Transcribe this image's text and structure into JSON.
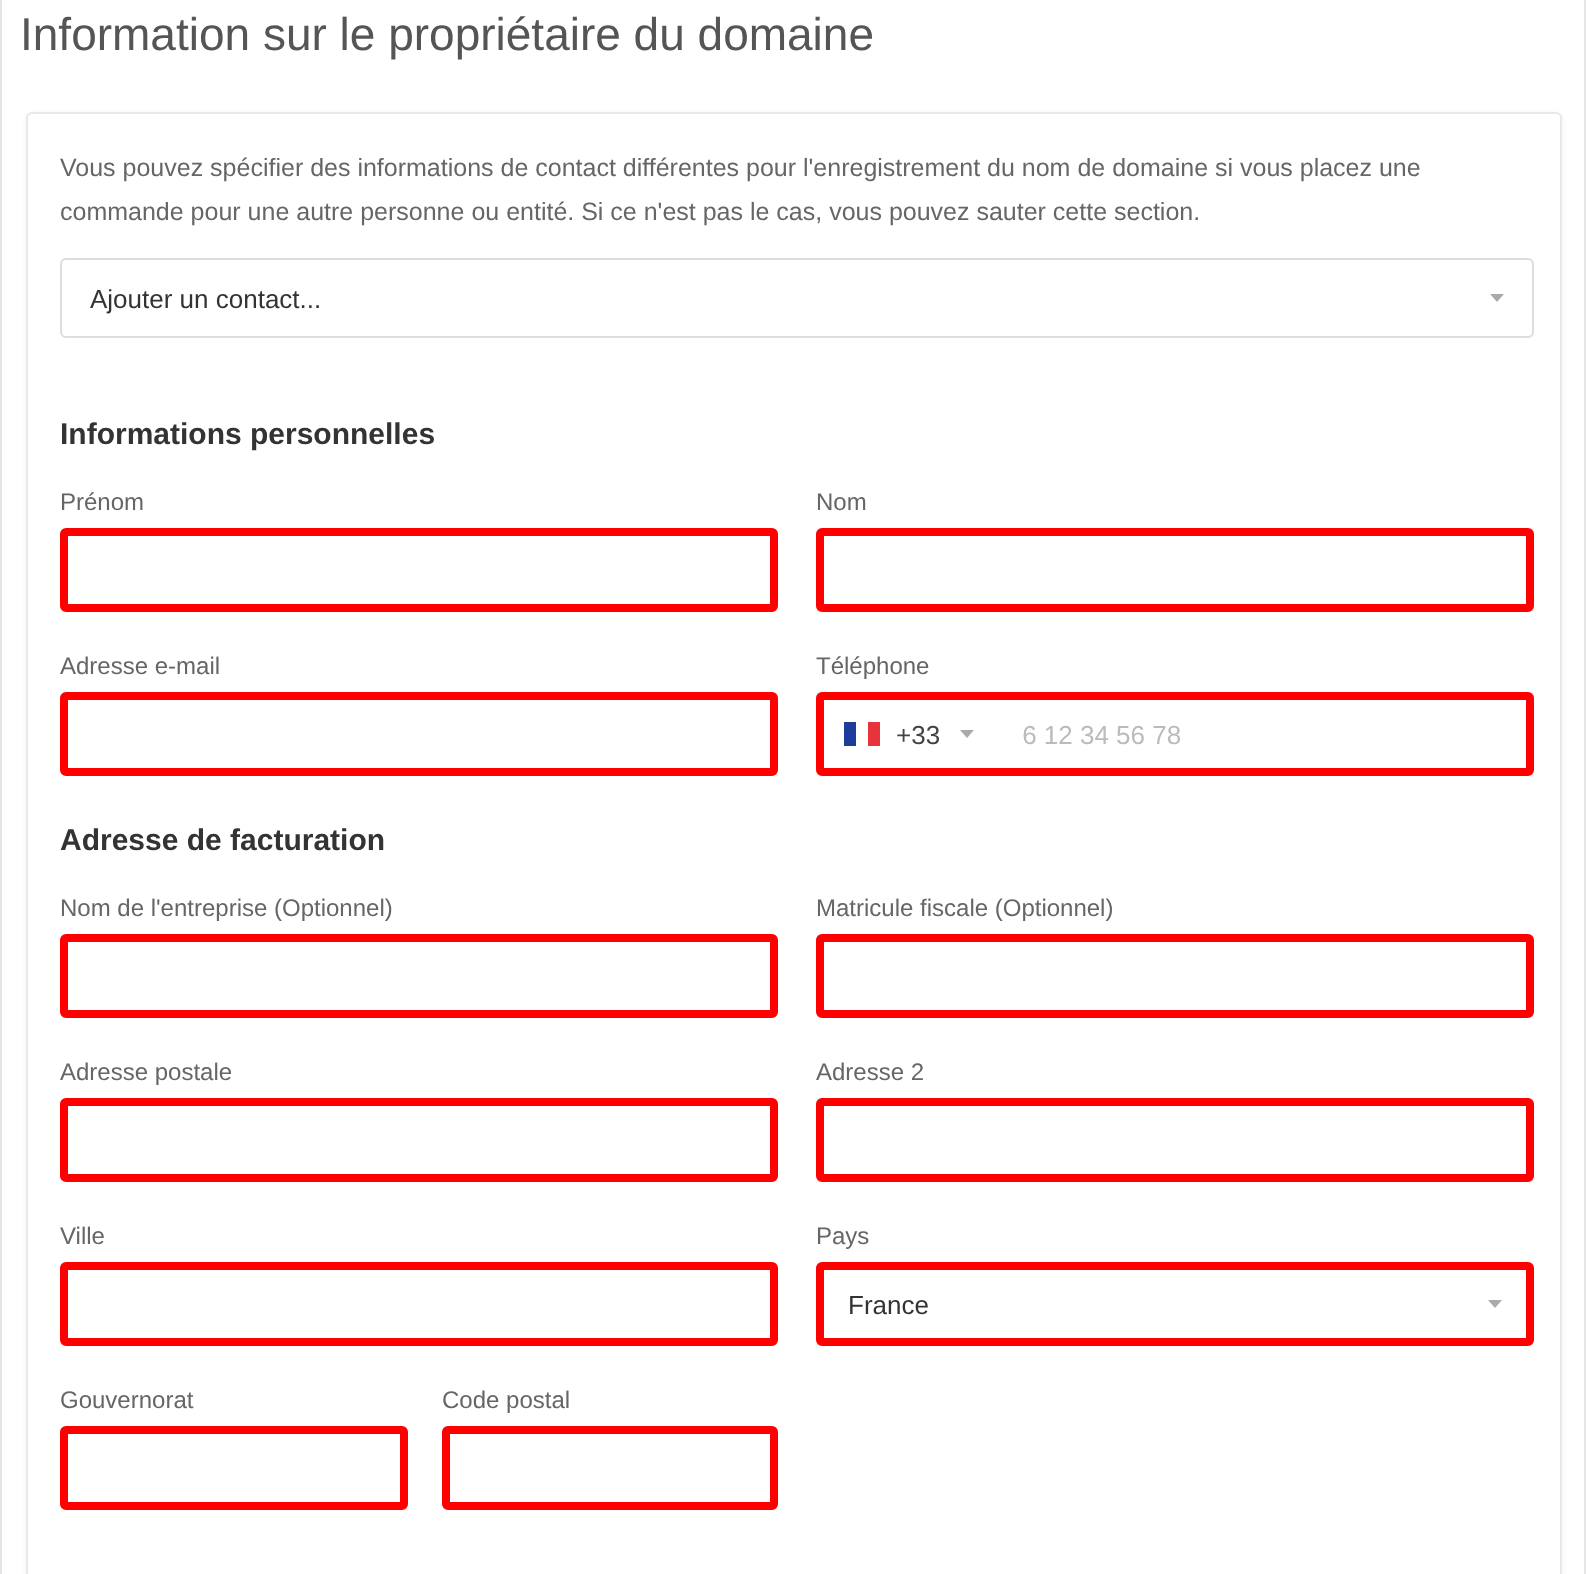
{
  "title": "Information sur le propriétaire du domaine",
  "intro": "Vous pouvez spécifier des informations de contact différentes pour l'enregistrement du nom de domaine si vous placez une commande pour une autre personne ou entité. Si ce n'est pas le cas, vous pouvez sauter cette section.",
  "contact_select": {
    "value": "Ajouter un contact..."
  },
  "sections": [
    {
      "heading": "Informations personnelles",
      "rows": [
        [
          {
            "label": "Prénom",
            "kind": "text",
            "invalid": true
          },
          {
            "label": "Nom",
            "kind": "text",
            "invalid": true
          }
        ],
        [
          {
            "label": "Adresse e-mail",
            "kind": "text",
            "invalid": true
          },
          {
            "label": "Téléphone",
            "kind": "phone",
            "code": "+33",
            "placeholder": "6 12 34 56 78",
            "invalid": true
          }
        ]
      ]
    },
    {
      "heading": "Adresse de facturation",
      "rows": [
        [
          {
            "label": "Nom de l'entreprise (Optionnel)",
            "kind": "text",
            "invalid": true
          },
          {
            "label": "Matricule fiscale (Optionnel)",
            "kind": "text",
            "invalid": true
          }
        ],
        [
          {
            "label": "Adresse postale",
            "kind": "text",
            "invalid": true
          },
          {
            "label": "Adresse 2",
            "kind": "text",
            "invalid": true
          }
        ],
        [
          {
            "label": "Ville",
            "kind": "text",
            "invalid": true
          },
          {
            "label": "Pays",
            "kind": "select",
            "value": "France",
            "invalid": true
          }
        ],
        [
          [
            {
              "label": "Gouvernorat",
              "kind": "text",
              "invalid": true
            },
            {
              "label": "Code postal",
              "kind": "text",
              "invalid": true
            }
          ]
        ]
      ]
    }
  ]
}
